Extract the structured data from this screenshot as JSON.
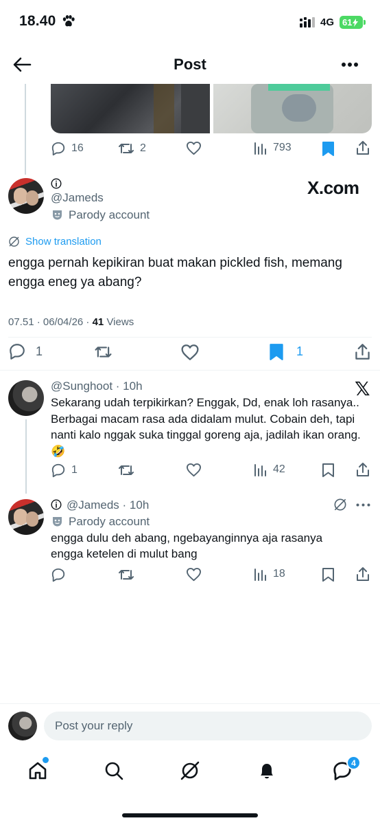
{
  "status_bar": {
    "time": "18.40",
    "network": "4G",
    "battery": "61"
  },
  "header": {
    "title": "Post"
  },
  "prev_post_actions": {
    "replies": "16",
    "reposts": "2",
    "views": "793"
  },
  "main_post": {
    "handle": "@Jameds",
    "parody_label": "Parody account",
    "source_watermark": "X.com",
    "show_translation": "Show translation",
    "text": "engga pernah kepikiran buat makan pickled fish, memang engga eneg ya abang?",
    "time": "07.51 · 06/04/26 · ",
    "views_count": "41",
    "views_label": " Views",
    "replies": "1",
    "bookmarks": "1"
  },
  "reply_1": {
    "handle": "@Sunghoot",
    "time": "· 10h",
    "text": "Sekarang udah terpikirkan? Enggak, Dd, enak loh rasanya.. Berbagai macam rasa ada didalam mulut. Cobain deh, tapi nanti kalo nggak suka tinggal goreng aja, jadilah ikan orang. 🤣",
    "replies": "1",
    "views": "42"
  },
  "reply_2": {
    "handle": "@Jameds",
    "time": "· 10h",
    "parody_label": "Parody account",
    "text": "engga dulu deh abang, ngebayanginnya aja rasanya engga ketelen di mulut bang",
    "views": "18"
  },
  "composer": {
    "placeholder": "Post your reply"
  },
  "tab_bar": {
    "messages_badge": "4"
  },
  "colors": {
    "accent": "#1d9bf0",
    "text": "#0f1419",
    "muted": "#536471",
    "battery": "#4cd964"
  }
}
